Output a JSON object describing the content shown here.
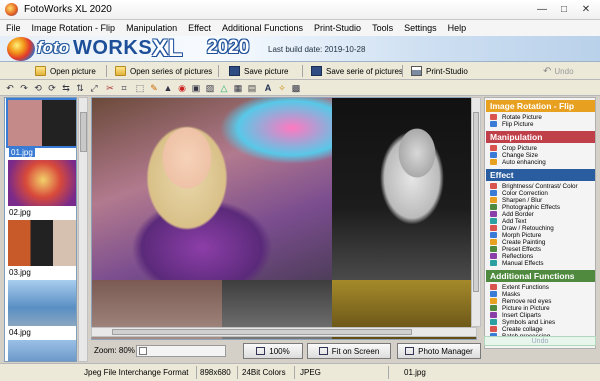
{
  "window": {
    "title": "FotoWorks XL 2020"
  },
  "menu": [
    "File",
    "Image Rotation - Flip",
    "Manipulation",
    "Effect",
    "Additional Functions",
    "Print-Studio",
    "Tools",
    "Settings",
    "Help"
  ],
  "banner": {
    "logo_foto": "foto",
    "logo_works": "WORKS",
    "logo_xl": "XL",
    "logo_year": "2020",
    "build": "Last build date:  2019-10-28"
  },
  "toolbar": {
    "open_picture": "Open picture",
    "open_series": "Open series of pictures",
    "save_picture": "Save picture",
    "save_series": "Save serie of pictures",
    "print_studio": "Print-Studio",
    "undo": "Undo"
  },
  "thumbnails": [
    {
      "label": "01.jpg",
      "selected": true
    },
    {
      "label": "02.jpg",
      "selected": false
    },
    {
      "label": "03.jpg",
      "selected": false
    },
    {
      "label": "04.jpg",
      "selected": false
    }
  ],
  "zoom": {
    "label": "Zoom: 80%",
    "level": 0.8
  },
  "view_buttons": {
    "hundred": "100%",
    "fit": "Fit on Screen",
    "manager": "Photo Manager"
  },
  "side": {
    "rotation": {
      "title": "Image Rotation - Flip",
      "items": [
        "Rotate Picture",
        "Flip Picture"
      ],
      "color": "#e8a020"
    },
    "manipulation": {
      "title": "Manipulation",
      "items": [
        "Crop Picture",
        "Change Size",
        "Auto enhancing"
      ],
      "color": "#c0404a"
    },
    "effect": {
      "title": "Effect",
      "items": [
        "Brightness/ Contrast/ Color",
        "Color Correction",
        "Sharpen / Blur",
        "Photographic Effects",
        "Add Border",
        "Add Text",
        "Draw / Retouching",
        "Morph Picture",
        "Create Painting",
        "Preset Effects",
        "Reflections",
        "Manual Effects"
      ],
      "color": "#2a5d9f"
    },
    "additional": {
      "title": "Additional Functions",
      "items": [
        "Extent Functions",
        "Masks",
        "Remove red eyes",
        "Picture in Picture",
        "Insert Cliparts",
        "Symbols and Lines",
        "Create collage",
        "Batch processing"
      ],
      "color": "#4f8a3e"
    },
    "undo": "Undo"
  },
  "status": {
    "format": "Jpeg File Interchange Format",
    "size": "898x680",
    "colors": "24Bit Colors",
    "type": "JPEG",
    "file": "01.jpg"
  }
}
